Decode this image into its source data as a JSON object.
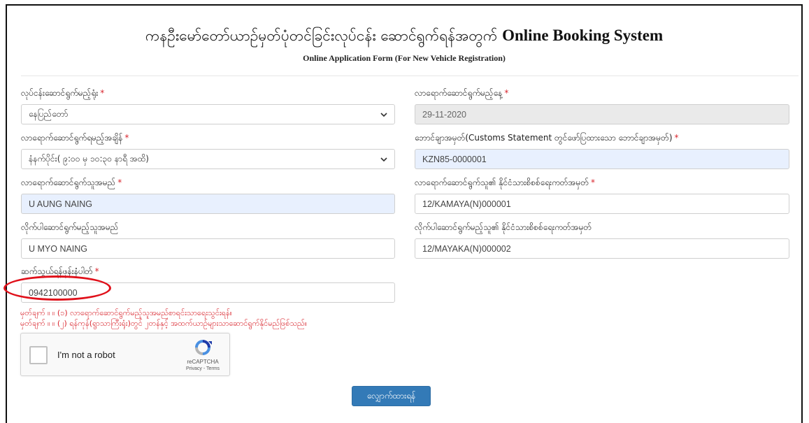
{
  "header": {
    "title_myanmar": "ကနဦးမော်တော်ယာဉ်မှတ်ပုံတင်ခြင်းလုပ်ငန်း ဆောင်ရွက်ရန်အတွက်",
    "title_latin": "Online Booking System",
    "subtitle": "Online Application Form (For New Vehicle Registration)"
  },
  "required_marker": "*",
  "form": {
    "office": {
      "label": "လုပ်ငန်းဆောင်ရွက်မည့်ရုံး",
      "value": "နေပြည်တော်"
    },
    "date": {
      "label": "လာရောက်ဆောင်ရွက်မည့်နေ့",
      "value": "29-11-2020"
    },
    "time": {
      "label": "လာရောက်ဆောင်ရွက်ရမည့်အချိန်",
      "value": "နံနက်ပိုင်း( ၉:၀၀ မှ ၁၀:၃၀ နာရီ အထိ)"
    },
    "invoice": {
      "label": "ဘောင်ချာအမှတ်(Customs Statement တွင်ဖော်ပြထားသော ဘောင်ချာအမှတ်)",
      "value": "KZN85-0000001"
    },
    "applicant_name": {
      "label": "လာရောက်ဆောင်ရွက်သူအမည်",
      "value": "U AUNG NAING"
    },
    "applicant_nrc": {
      "label": "လာရောက်ဆောင်ရွက်သူ၏ နိုင်ငံသားစိစစ်ရေးကတ်အမှတ်",
      "value": "12/KAMAYA(N)000001"
    },
    "companion_name": {
      "label": "လိုက်ပါဆောင်ရွက်မည့်သူအမည်",
      "value": "U MYO NAING"
    },
    "companion_nrc": {
      "label": "လိုက်ပါဆောင်ရွက်မည့်သူ၏ နိုင်ငံသားစိစစ်ရေးကတ်အမှတ်",
      "value": "12/MAYAKA(N)000002"
    },
    "phone": {
      "label": "ဆက်သွယ်ရန်ဖုန်းနံပါတ်",
      "value": "0942100000"
    }
  },
  "notes": [
    "မှတ်ချက် ။ ။ (၁) လာရောက်ဆောင်ရွက်မည့်သူအမည်စာရင်းသာရေးသွင်းရန်။",
    "မှတ်ချက် ။ ။ (၂) ရန်ကုန်(ရွာသာကြီးရုံး)တွင် ၂တန်နှင့် အထက်ယာဉ်များသာဆောင်ရွက်နိုင်မည်ဖြစ်သည်။"
  ],
  "captcha": {
    "label": "I'm not a robot",
    "brand": "reCAPTCHA",
    "links": "Privacy - Terms"
  },
  "submit_label": "လျှောက်ထားရန်",
  "colors": {
    "accent": "#337ab7",
    "required": "#d9262e",
    "highlight_circle": "#e0101a",
    "autofill": "#e8f0fe",
    "readonly": "#eaeaea"
  },
  "icons": {
    "select_arrow": "chevron-down-icon",
    "captcha_logo": "recaptcha-icon"
  }
}
